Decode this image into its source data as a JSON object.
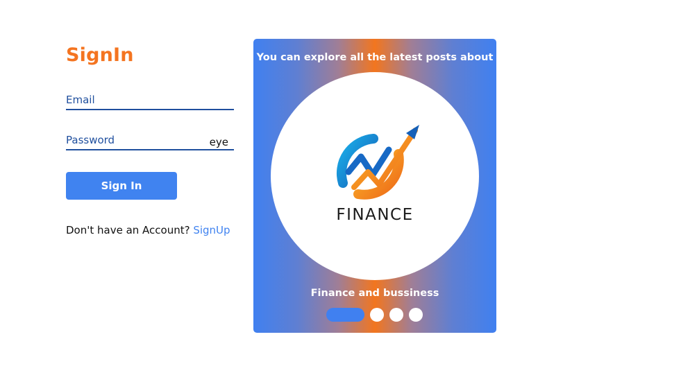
{
  "signin": {
    "title": "SignIn",
    "email_placeholder": "Email",
    "password_placeholder": "Password",
    "password_toggle": "eye",
    "submit_label": "Sign In",
    "signup_prompt": "Don't have an Account? ",
    "signup_link": "SignUp"
  },
  "carousel": {
    "heading": "You can explore all the latest posts about",
    "logo_text": "FINANCE",
    "caption": "Finance and bussiness",
    "slide_count": 4,
    "active_slide": 1
  },
  "colors": {
    "accent_orange": "#f47420",
    "primary_blue": "#4083f0",
    "field_underline": "#1f4f9e"
  }
}
